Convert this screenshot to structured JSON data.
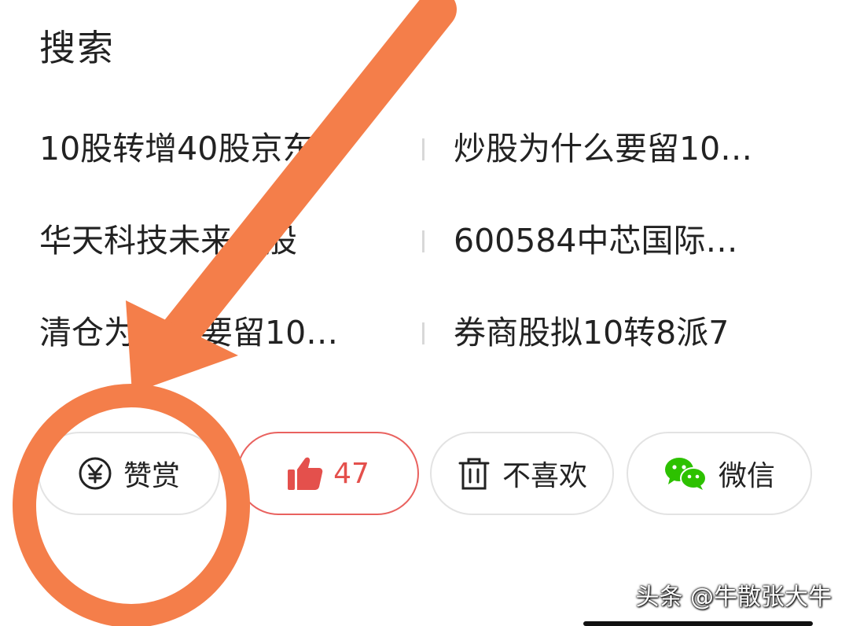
{
  "section": {
    "title": "搜索"
  },
  "search": {
    "rows": [
      {
        "left": "10股转增40股京东方",
        "right": "炒股为什么要留10…"
      },
      {
        "left": "华天科技未来牛股",
        "right": "600584中芯国际…"
      },
      {
        "left": "清仓为什么要留10…",
        "right": "券商股拟10转8派7"
      }
    ]
  },
  "actions": {
    "reward": {
      "label": "赞赏",
      "icon": "yen-circle-icon"
    },
    "like": {
      "count": "47",
      "icon": "thumbs-up-icon"
    },
    "dislike": {
      "label": "不喜欢",
      "icon": "trash-icon"
    },
    "wechat": {
      "label": "微信",
      "icon": "wechat-icon"
    }
  },
  "annotation": {
    "arrow_color": "#f47e4a",
    "circle_color": "#f47e4a"
  },
  "watermark": {
    "text": "头条 @牛散张大牛"
  },
  "colors": {
    "like_red": "#e4504c",
    "wechat_green": "#2dc100",
    "divider_gray": "#d8d8d8",
    "border_gray": "#e3e3e3"
  }
}
